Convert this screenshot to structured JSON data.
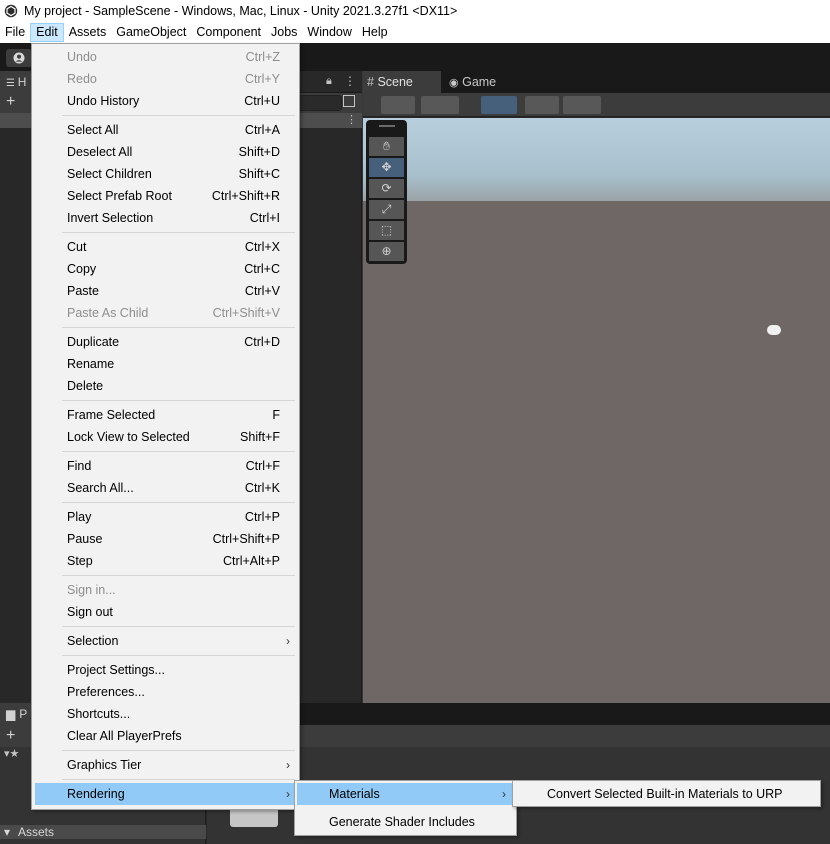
{
  "window": {
    "title": "My project - SampleScene - Windows, Mac, Linux - Unity 2021.3.27f1 <DX11>"
  },
  "menubar": {
    "items": [
      "File",
      "Edit",
      "Assets",
      "GameObject",
      "Component",
      "Jobs",
      "Window",
      "Help"
    ],
    "active": "Edit"
  },
  "hierarchy": {
    "tab_label": "H"
  },
  "scene_view": {
    "tabs": [
      {
        "label": "Scene",
        "icon": "hash-icon",
        "active": true
      },
      {
        "label": "Game",
        "icon": "gamepad-icon",
        "active": false
      }
    ],
    "sky_color": "#b8cfdd",
    "ground_color": "#6e6766"
  },
  "tools": [
    "hand-tool",
    "move-tool",
    "rotate-tool",
    "scale-tool",
    "rect-tool",
    "transform-tool"
  ],
  "project_panel": {
    "tab_label": "P",
    "assets_label": "Assets"
  },
  "edit_menu": {
    "items": [
      {
        "label": "Undo",
        "shortcut": "Ctrl+Z",
        "disabled": true
      },
      {
        "label": "Redo",
        "shortcut": "Ctrl+Y",
        "disabled": true
      },
      {
        "label": "Undo History",
        "shortcut": "Ctrl+U"
      },
      {
        "label": "Select All",
        "shortcut": "Ctrl+A"
      },
      {
        "label": "Deselect All",
        "shortcut": "Shift+D"
      },
      {
        "label": "Select Children",
        "shortcut": "Shift+C"
      },
      {
        "label": "Select Prefab Root",
        "shortcut": "Ctrl+Shift+R"
      },
      {
        "label": "Invert Selection",
        "shortcut": "Ctrl+I"
      },
      {
        "label": "Cut",
        "shortcut": "Ctrl+X"
      },
      {
        "label": "Copy",
        "shortcut": "Ctrl+C"
      },
      {
        "label": "Paste",
        "shortcut": "Ctrl+V"
      },
      {
        "label": "Paste As Child",
        "shortcut": "Ctrl+Shift+V",
        "disabled": true
      },
      {
        "label": "Duplicate",
        "shortcut": "Ctrl+D"
      },
      {
        "label": "Rename",
        "shortcut": ""
      },
      {
        "label": "Delete",
        "shortcut": ""
      },
      {
        "label": "Frame Selected",
        "shortcut": "F"
      },
      {
        "label": "Lock View to Selected",
        "shortcut": "Shift+F"
      },
      {
        "label": "Find",
        "shortcut": "Ctrl+F"
      },
      {
        "label": "Search All...",
        "shortcut": "Ctrl+K"
      },
      {
        "label": "Play",
        "shortcut": "Ctrl+P"
      },
      {
        "label": "Pause",
        "shortcut": "Ctrl+Shift+P"
      },
      {
        "label": "Step",
        "shortcut": "Ctrl+Alt+P"
      },
      {
        "label": "Sign in...",
        "shortcut": "",
        "disabled": true
      },
      {
        "label": "Sign out",
        "shortcut": ""
      },
      {
        "label": "Selection",
        "shortcut": "",
        "submenu": true
      },
      {
        "label": "Project Settings...",
        "shortcut": ""
      },
      {
        "label": "Preferences...",
        "shortcut": ""
      },
      {
        "label": "Shortcuts...",
        "shortcut": ""
      },
      {
        "label": "Clear All PlayerPrefs",
        "shortcut": ""
      },
      {
        "label": "Graphics Tier",
        "shortcut": "",
        "submenu": true
      },
      {
        "label": "Rendering",
        "shortcut": "",
        "submenu": true,
        "highlighted": true
      }
    ]
  },
  "rendering_submenu": {
    "items": [
      {
        "label": "Materials",
        "submenu": true,
        "highlighted": true
      },
      {
        "label": "Generate Shader Includes"
      }
    ]
  },
  "materials_submenu": {
    "items": [
      {
        "label": "Convert Selected Built-in Materials to URP"
      }
    ]
  },
  "colors": {
    "menu_highlight": "#91c9f7",
    "menubar_active": "#cce8ff",
    "selected_tool": "#46607c"
  }
}
